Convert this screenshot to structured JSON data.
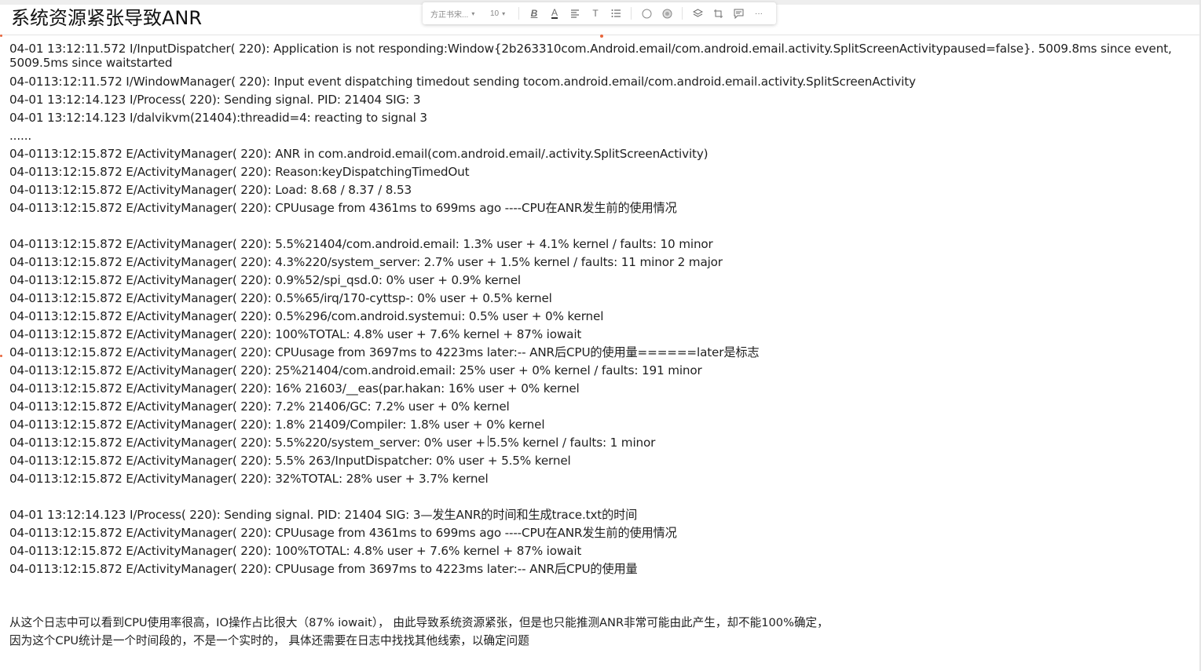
{
  "title": "系统资源紧张导致ANR",
  "toolbar": {
    "font_name": "方正书宋...",
    "font_size": "10",
    "buttons": [
      {
        "icon": "bold-icon",
        "glyph": "B"
      },
      {
        "icon": "text-color-icon",
        "glyph": "A"
      },
      {
        "icon": "align-icon",
        "glyph": "≣"
      },
      {
        "icon": "text-style-icon",
        "glyph": "T"
      },
      {
        "icon": "list-icon",
        "glyph": "☰"
      },
      {
        "icon": "circle-icon",
        "glyph": "○"
      },
      {
        "icon": "fill-icon",
        "glyph": "◎"
      },
      {
        "icon": "layers-icon",
        "glyph": "◈"
      },
      {
        "icon": "crop-icon",
        "glyph": "⧉"
      },
      {
        "icon": "comment-icon",
        "glyph": "▤"
      },
      {
        "icon": "more-icon",
        "glyph": "···"
      }
    ]
  },
  "log_lines": [
    "04-01 13:12:11.572 I/InputDispatcher( 220): Application is not responding:Window{2b263310com.Android.email/com.android.email.activity.SplitScreenActivitypaused=false}.  5009.8ms since event, 5009.5ms since waitstarted",
    "04-0113:12:11.572 I/WindowManager( 220): Input event dispatching timedout sending tocom.android.email/com.android.email.activity.SplitScreenActivity",
    "04-01 13:12:14.123 I/Process(  220): Sending signal. PID: 21404 SIG: 3",
    "04-01 13:12:14.123 I/dalvikvm(21404):threadid=4: reacting to signal 3",
    "......",
    "04-0113:12:15.872 E/ActivityManager(  220): ANR in com.android.email(com.android.email/.activity.SplitScreenActivity)",
    "04-0113:12:15.872 E/ActivityManager(  220): Reason:keyDispatchingTimedOut",
    "04-0113:12:15.872 E/ActivityManager(  220): Load: 8.68 / 8.37 / 8.53",
    "04-0113:12:15.872 E/ActivityManager(  220): CPUusage from 4361ms to 699ms ago ----CPU在ANR发生前的使用情况",
    "04-0113:12:15.872 E/ActivityManager(  220):   5.5%21404/com.android.email: 1.3% user + 4.1% kernel / faults: 10 minor",
    "04-0113:12:15.872 E/ActivityManager(  220):   4.3%220/system_server: 2.7% user + 1.5% kernel / faults: 11 minor 2 major",
    "04-0113:12:15.872 E/ActivityManager(  220):   0.9%52/spi_qsd.0: 0% user + 0.9% kernel",
    "04-0113:12:15.872 E/ActivityManager(  220):   0.5%65/irq/170-cyttsp-: 0% user + 0.5% kernel",
    "04-0113:12:15.872 E/ActivityManager(  220):   0.5%296/com.android.systemui: 0.5% user + 0% kernel",
    "04-0113:12:15.872 E/ActivityManager(  220): 100%TOTAL: 4.8% user + 7.6% kernel + 87% iowait",
    "04-0113:12:15.872 E/ActivityManager(  220): CPUusage from 3697ms to 4223ms later:-- ANR后CPU的使用量======later是标志",
    "04-0113:12:15.872 E/ActivityManager(  220):   25%21404/com.android.email: 25% user + 0% kernel / faults: 191 minor",
    "04-0113:12:15.872 E/ActivityManager(  220):    16% 21603/__eas(par.hakan: 16% user + 0% kernel",
    "04-0113:12:15.872 E/ActivityManager(  220):    7.2% 21406/GC: 7.2% user + 0% kernel",
    "04-0113:12:15.872 E/ActivityManager(  220):    1.8% 21409/Compiler: 1.8% user + 0% kernel",
    "04-0113:12:15.872 E/ActivityManager(  220):   5.5%220/system_server: 0% user + 5.5% kernel / faults: 1 minor",
    "04-0113:12:15.872 E/ActivityManager(  220):    5.5% 263/InputDispatcher: 0% user + 5.5% kernel",
    "04-0113:12:15.872 E/ActivityManager(  220): 32%TOTAL: 28% user + 3.7% kernel",
    "04-01 13:12:14.123 I/Process( 220): Sending signal. PID: 21404 SIG: 3—发生ANR的时间和生成trace.txt的时间",
    "04-0113:12:15.872 E/ActivityManager( 220): CPUusage from 4361ms to 699ms ago ----CPU在ANR发生前的使用情况",
    "04-0113:12:15.872 E/ActivityManager( 220): 100%TOTAL: 4.8% user + 7.6% kernel + 87% iowait",
    "04-0113:12:15.872 E/ActivityManager( 220): CPUusage from 3697ms to 4223ms later:-- ANR后CPU的使用量"
  ],
  "notes": [
    "从这个日志中可以看到CPU使用率很高，IO操作占比很大（87% iowait），  由此导致系统资源紧张，但是也只能推测ANR非常可能由此产生，却不能100%确定，",
    " 因为这个CPU统计是一个时间段的，不是一个实时的，  具体还需要在日志中找找其他线索，以确定问题"
  ]
}
